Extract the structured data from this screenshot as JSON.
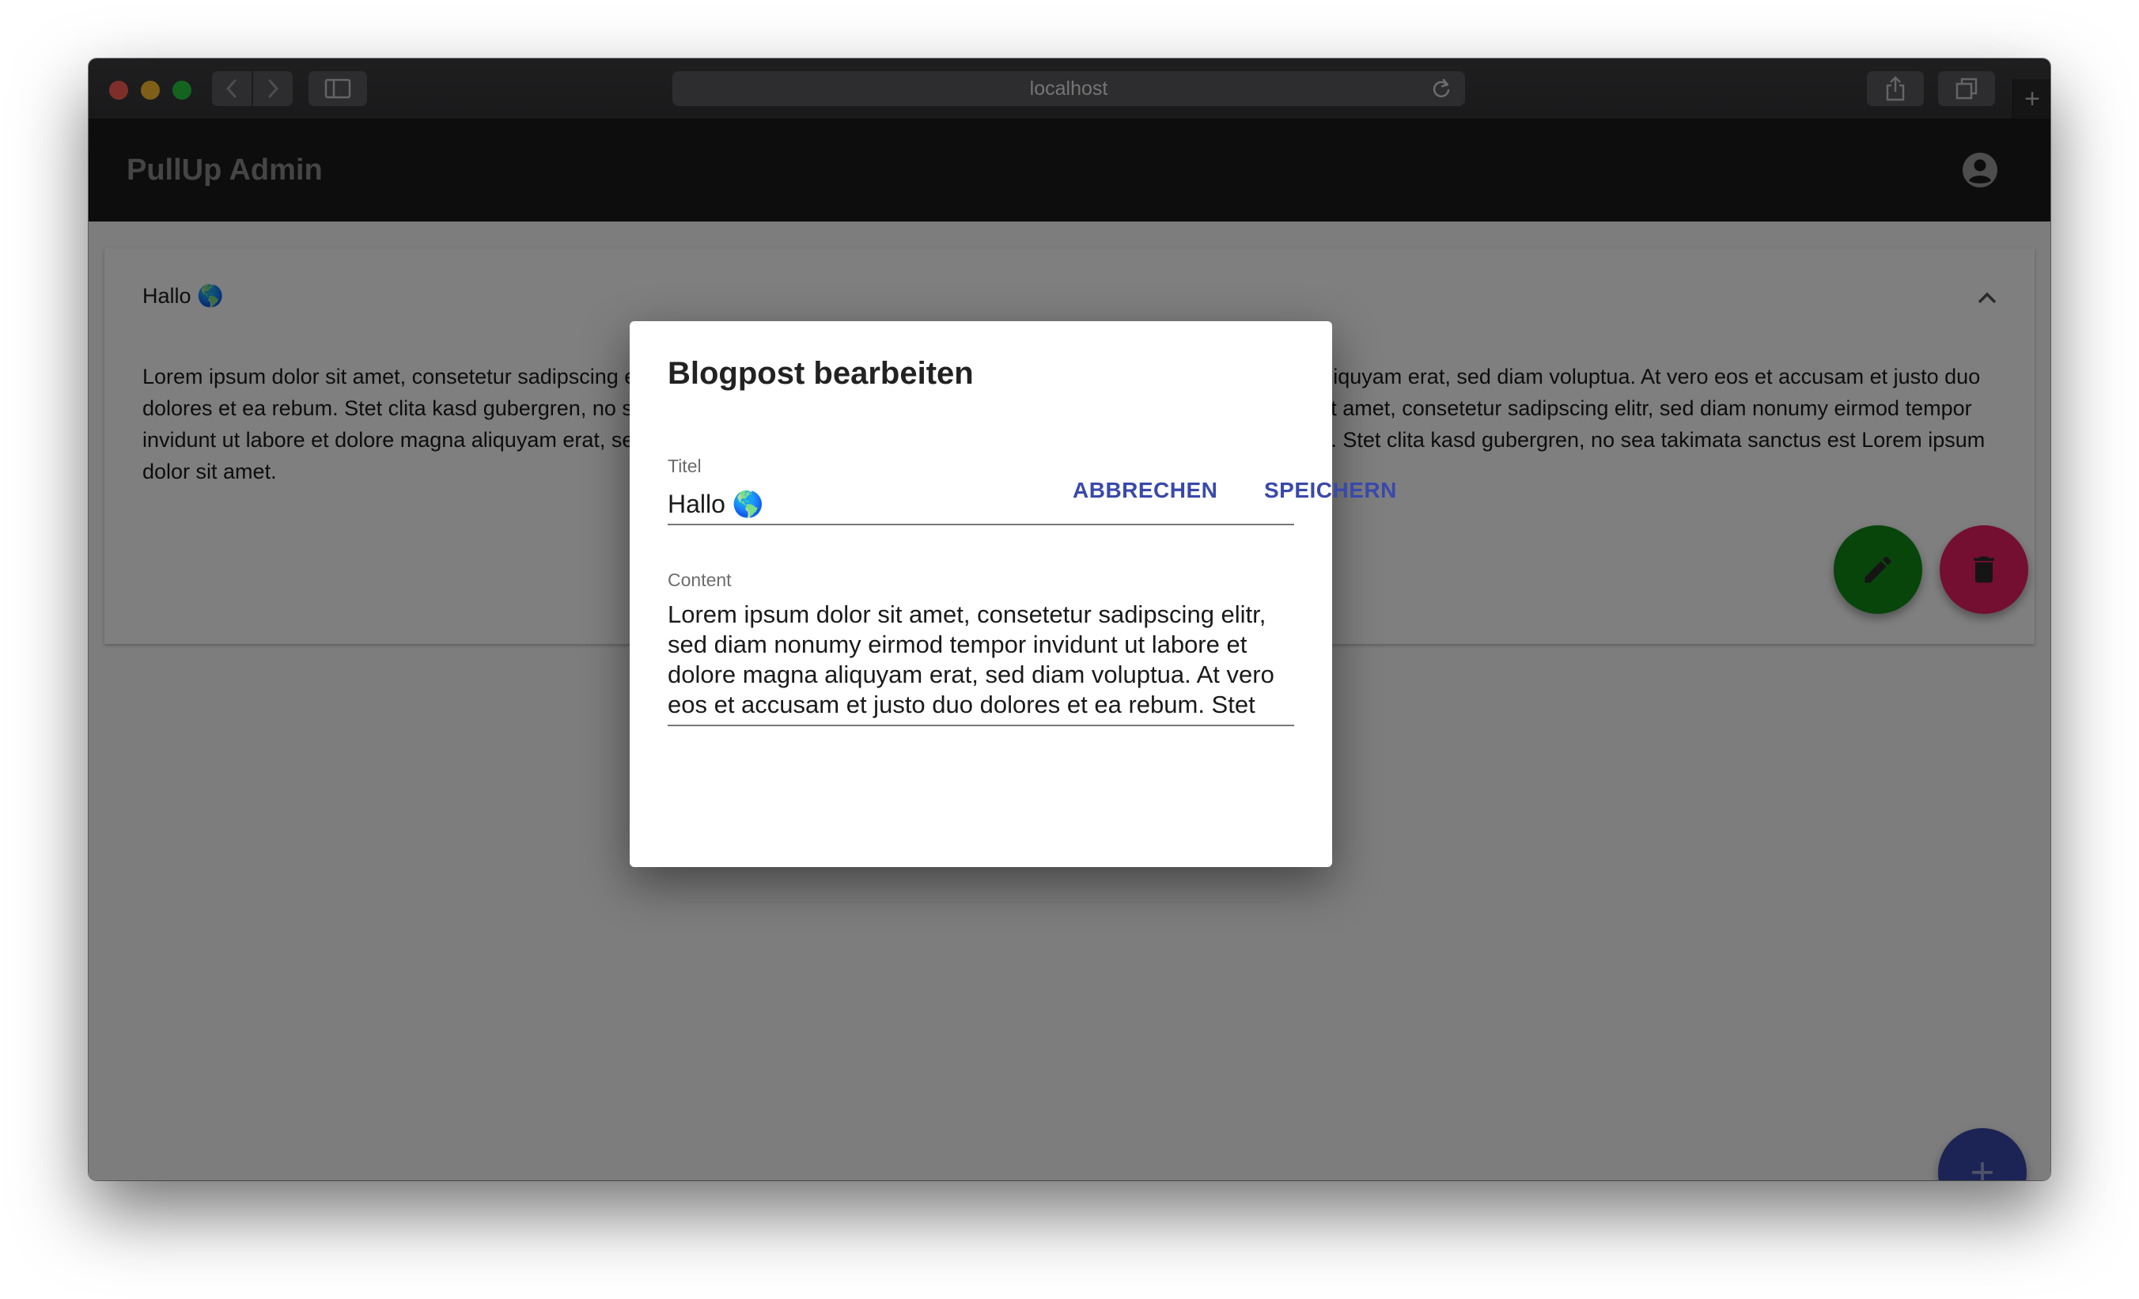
{
  "browser": {
    "url": "localhost"
  },
  "app": {
    "title": "PullUp Admin"
  },
  "post": {
    "title": "Hallo 🌎",
    "body": "Lorem ipsum dolor sit amet, consetetur sadipscing elitr, sed diam nonumy eirmod tempor invidunt ut labore et dolore magna aliquyam erat, sed diam voluptua. At vero eos et accusam et justo duo dolores et ea rebum. Stet clita kasd gubergren, no sea takimata sanctus est Lorem ipsum dolor sit amet. Lorem ipsum dolor sit amet, consetetur sadipscing elitr, sed diam nonumy eirmod tempor invidunt ut labore et dolore magna aliquyam erat, sed diam voluptua. At vero eos et accusam et justo duo dolores et ea rebum. Stet clita kasd gubergren, no sea takimata sanctus est Lorem ipsum dolor sit amet."
  },
  "dialog": {
    "title": "Blogpost bearbeiten",
    "title_label": "Titel",
    "title_value": "Hallo 🌎",
    "content_label": "Content",
    "content_value": "Lorem ipsum dolor sit amet, consetetur sadipscing elitr, sed diam nonumy eirmod tempor invidunt ut labore et dolore magna aliquyam erat, sed diam voluptua. At vero eos et accusam et justo duo dolores et ea rebum. Stet",
    "cancel_label": "ABBRECHEN",
    "save_label": "SPEICHERN"
  },
  "colors": {
    "edit_fab": "#0e8a16",
    "delete_fab": "#e91e63",
    "add_fab": "#3949ab",
    "primary": "#3949ab"
  },
  "icons": {
    "edit": "pencil-icon",
    "delete": "trash-icon",
    "add": "plus-icon",
    "account": "account-circle-icon",
    "collapse": "chevron-up-icon"
  }
}
